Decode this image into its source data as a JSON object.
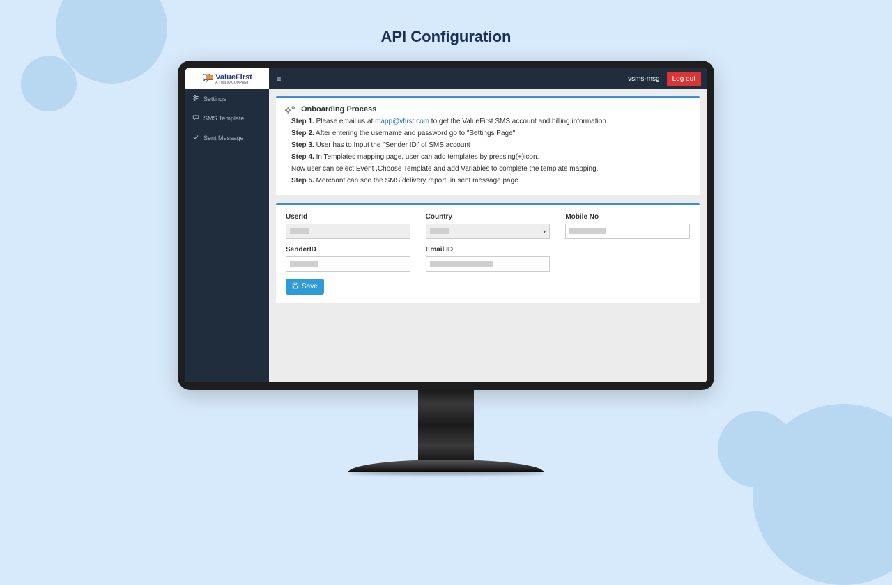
{
  "pageTitle": "API Configuration",
  "brand": {
    "name": "ValueFirst",
    "tagline": "A TWILIO COMPANY"
  },
  "topbar": {
    "user": "vsms-msg",
    "logout": "Log out"
  },
  "sidebar": {
    "items": [
      {
        "label": "Settings"
      },
      {
        "label": "SMS Template"
      },
      {
        "label": "Sent Message"
      }
    ]
  },
  "onboarding": {
    "title": "Onboarding Process",
    "step1_label": "Step 1.",
    "step1_a": " Please email us at ",
    "step1_email": "mapp@vfirst.com",
    "step1_b": " to get the ValueFirst SMS account and billing information",
    "step2_label": "Step 2.",
    "step2": " After entering the username and password go to \"Settings Page\"",
    "step3_label": "Step 3.",
    "step3": " User has to Input the \"Sender ID\" of SMS account",
    "step4_label": "Step 4.",
    "step4": " In Templates mapping page, user can add templates by pressing(+)icon.",
    "step4_note": "Now user can select Event ,Choose Template and add Variables to complete the template mapping.",
    "step5_label": "Step 5.",
    "step5": " Merchant can see the SMS delivery report. in sent message page"
  },
  "form": {
    "userId": {
      "label": "UserId"
    },
    "country": {
      "label": "Country"
    },
    "mobile": {
      "label": "Mobile No"
    },
    "senderId": {
      "label": "SenderID"
    },
    "email": {
      "label": "Email ID"
    },
    "save": "Save"
  }
}
